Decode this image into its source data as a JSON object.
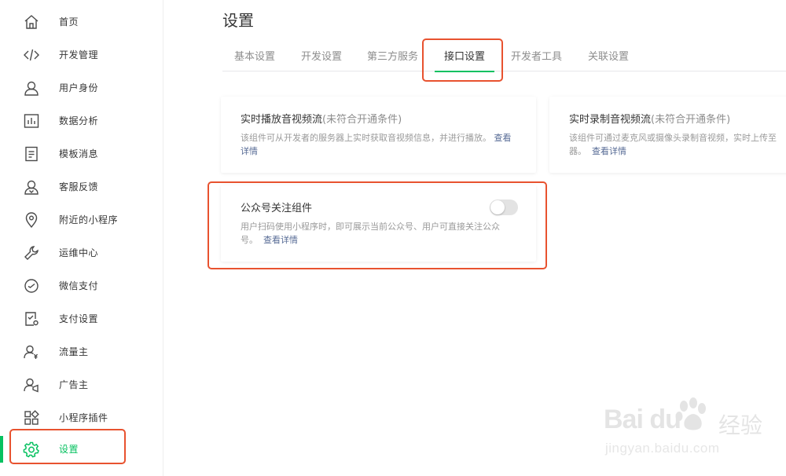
{
  "sidebar": {
    "items": [
      {
        "label": "首页",
        "icon": "home-icon"
      },
      {
        "label": "开发管理",
        "icon": "code-icon"
      },
      {
        "label": "用户身份",
        "icon": "user-icon"
      },
      {
        "label": "数据分析",
        "icon": "chart-icon"
      },
      {
        "label": "模板消息",
        "icon": "document-icon"
      },
      {
        "label": "客服反馈",
        "icon": "customer-service-icon"
      },
      {
        "label": "附近的小程序",
        "icon": "location-icon"
      },
      {
        "label": "运维中心",
        "icon": "wrench-icon"
      },
      {
        "label": "微信支付",
        "icon": "payment-icon"
      },
      {
        "label": "支付设置",
        "icon": "payment-settings-icon"
      },
      {
        "label": "流量主",
        "icon": "traffic-owner-icon"
      },
      {
        "label": "广告主",
        "icon": "advertiser-icon"
      },
      {
        "label": "小程序插件",
        "icon": "plugin-icon"
      },
      {
        "label": "设置",
        "icon": "gear-icon",
        "active": true
      }
    ]
  },
  "main": {
    "title": "设置",
    "tabs": [
      {
        "label": "基本设置"
      },
      {
        "label": "开发设置"
      },
      {
        "label": "第三方服务"
      },
      {
        "label": "接口设置",
        "active": true
      },
      {
        "label": "开发者工具"
      },
      {
        "label": "关联设置"
      }
    ],
    "cards": [
      {
        "title": "实时播放音视频流",
        "note": "(未符合开通条件)",
        "description": "该组件可从开发者的服务器上实时获取音视频信息，并进行播放。",
        "link": "查看详情"
      },
      {
        "title": "实时录制音视频流",
        "note": "(未符合开通条件)",
        "description": "该组件可通过麦克风或摄像头录制音视频，实时上传至",
        "description_tail": "器。",
        "link": "查看详情"
      },
      {
        "title": "公众号关注组件",
        "description": "用户扫码使用小程序时，即可展示当前公众号、用户可直接关注公众号。",
        "link": "查看详情",
        "toggle": "off"
      }
    ]
  },
  "watermark": {
    "brand": "Bai du",
    "cn": "经验",
    "url": "jingyan.baidu.com"
  },
  "colors": {
    "accent": "#07c160",
    "link": "#576b95",
    "highlight": "#e8522f"
  }
}
